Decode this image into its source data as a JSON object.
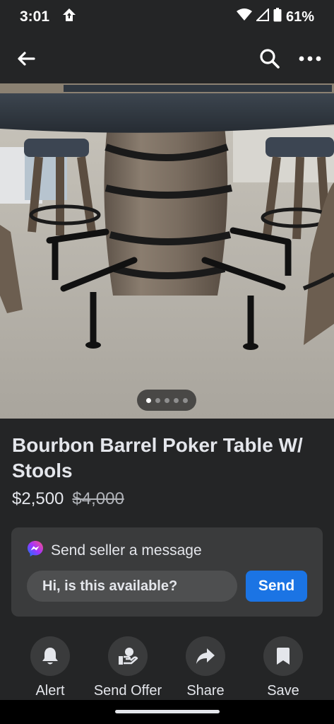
{
  "status_bar": {
    "time": "3:01",
    "battery": "61%"
  },
  "listing": {
    "title": "Bourbon Barrel Poker Table W/ Stools",
    "price": "$2,500",
    "original_price": "$4,000",
    "photo_count": 5,
    "current_photo": 1
  },
  "message": {
    "header": "Send seller a message",
    "input_value": "Hi, is this available?",
    "send_label": "Send"
  },
  "actions": {
    "alert": "Alert",
    "send_offer": "Send Offer",
    "share": "Share",
    "save": "Save"
  },
  "colors": {
    "background": "#242526",
    "card": "#3a3b3c",
    "accent": "#1b74e4"
  }
}
